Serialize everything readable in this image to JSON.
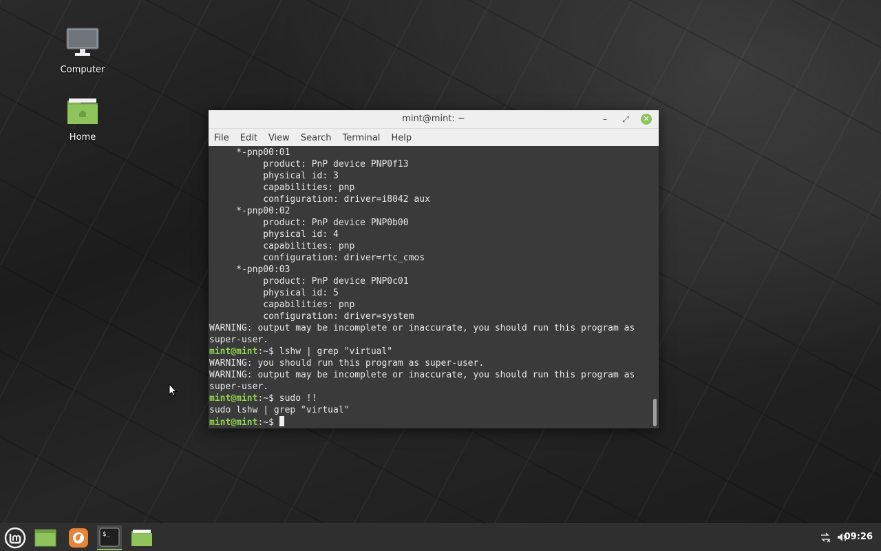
{
  "desktop": {
    "icons": [
      {
        "label": "Computer",
        "icon": "computer-icon"
      },
      {
        "label": "Home",
        "icon": "home-folder-icon"
      }
    ]
  },
  "window": {
    "title": "mint@mint: ~",
    "menu": [
      "File",
      "Edit",
      "View",
      "Search",
      "Terminal",
      "Help"
    ]
  },
  "terminal": {
    "prompt_user": "mint@mint",
    "prompt_suffix": ":~$",
    "lines": [
      {
        "text": "     *-pnp00:01"
      },
      {
        "text": "          product: PnP device PNP0f13"
      },
      {
        "text": "          physical id: 3"
      },
      {
        "text": "          capabilities: pnp"
      },
      {
        "text": "          configuration: driver=i8042 aux"
      },
      {
        "text": "     *-pnp00:02"
      },
      {
        "text": "          product: PnP device PNP0b00"
      },
      {
        "text": "          physical id: 4"
      },
      {
        "text": "          capabilities: pnp"
      },
      {
        "text": "          configuration: driver=rtc_cmos"
      },
      {
        "text": "     *-pnp00:03"
      },
      {
        "text": "          product: PnP device PNP0c01"
      },
      {
        "text": "          physical id: 5"
      },
      {
        "text": "          capabilities: pnp"
      },
      {
        "text": "          configuration: driver=system"
      },
      {
        "text": "WARNING: output may be incomplete or inaccurate, you should run this program as"
      },
      {
        "text": "super-user."
      },
      {
        "prompt": true,
        "text": " lshw | grep \"virtual\""
      },
      {
        "text": "WARNING: you should run this program as super-user."
      },
      {
        "text": "WARNING: output may be incomplete or inaccurate, you should run this program as"
      },
      {
        "text": "super-user."
      },
      {
        "prompt": true,
        "text": " sudo !!"
      },
      {
        "text": "sudo lshw | grep \"virtual\""
      },
      {
        "prompt": true,
        "text": " ",
        "cursor": true
      }
    ]
  },
  "taskbar": {
    "items": [
      "mint-menu-icon",
      "show-desktop-icon",
      "firefox-icon",
      "terminal-icon",
      "files-icon"
    ],
    "clock": "09:26"
  },
  "colors": {
    "accent": "#8fc35c",
    "prompt": "#8fd14f",
    "terminal_bg": "#3a3a3a"
  }
}
